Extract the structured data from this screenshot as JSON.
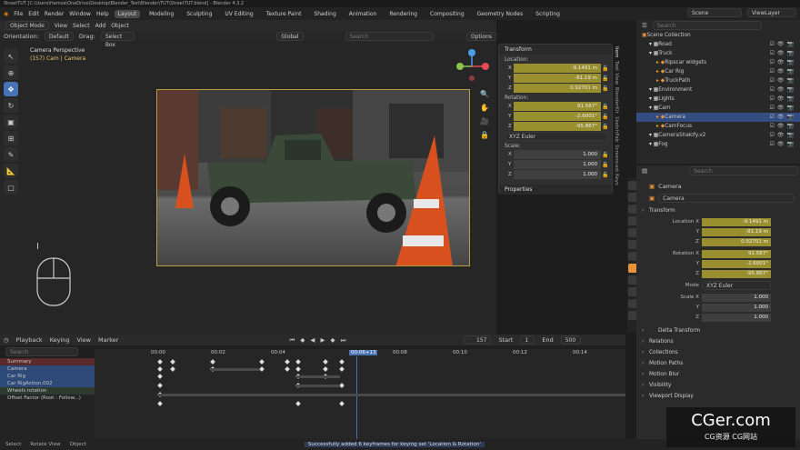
{
  "window": {
    "title": "StreetTUT [C:\\Users\\Hamza\\OneDrive\\Desktop\\Blender_Test\\Blender\\TUT\\StreetTUT.blend] - Blender 4.3.2"
  },
  "menu": [
    "File",
    "Edit",
    "Render",
    "Window",
    "Help"
  ],
  "workspaces": [
    "Layout",
    "Modeling",
    "Sculpting",
    "UV Editing",
    "Texture Paint",
    "Shading",
    "Animation",
    "Rendering",
    "Compositing",
    "Geometry Nodes",
    "Scripting"
  ],
  "scene": {
    "scene_name": "Scene",
    "view_layer": "ViewLayer"
  },
  "viewport": {
    "mode": "Object Mode",
    "menus": [
      "View",
      "Select",
      "Add",
      "Object"
    ],
    "orientation_label": "Orientation:",
    "orientation_value": "Default",
    "drag_label": "Drag:",
    "drag_value": "Select Box",
    "transform_orientation": "Global",
    "options": "Options",
    "camera_title": "Camera Perspective",
    "camera_sub": "(157) Cam | Camera",
    "search_placeholder": "Search"
  },
  "npanel": {
    "transform": "Transform",
    "location": "Location:",
    "loc": [
      {
        "axis": "X",
        "value": "-9.1491 m"
      },
      {
        "axis": "Y",
        "value": "-81.19 m"
      },
      {
        "axis": "Z",
        "value": "0.92701 m"
      }
    ],
    "rotation": "Rotation:",
    "rot": [
      {
        "axis": "X",
        "value": "91.567°"
      },
      {
        "axis": "Y",
        "value": "-2.6001°"
      },
      {
        "axis": "Z",
        "value": "-95.867°"
      }
    ],
    "rotation_mode": "XYZ Euler",
    "scale": "Scale:",
    "scl": [
      {
        "axis": "X",
        "value": "1.000"
      },
      {
        "axis": "Y",
        "value": "1.000"
      },
      {
        "axis": "Z",
        "value": "1.000"
      }
    ],
    "properties": "Properties",
    "side_tabs": [
      "Item",
      "Tool",
      "View",
      "BlenderKit",
      "SketchFab",
      "Screencast Keys"
    ]
  },
  "outliner": {
    "search_placeholder": "Search",
    "items": [
      {
        "name": "Scene Collection",
        "indent": 0,
        "sel": false
      },
      {
        "name": "Road",
        "indent": 1,
        "sel": false
      },
      {
        "name": "Truck",
        "indent": 1,
        "sel": false
      },
      {
        "name": "Ripscar widgets",
        "indent": 2,
        "sel": false
      },
      {
        "name": "Car Rig",
        "indent": 2,
        "sel": false
      },
      {
        "name": "TruckPath",
        "indent": 2,
        "sel": false
      },
      {
        "name": "Environment",
        "indent": 1,
        "sel": false
      },
      {
        "name": "Lights",
        "indent": 1,
        "sel": false
      },
      {
        "name": "Cam",
        "indent": 1,
        "sel": false
      },
      {
        "name": "Camera",
        "indent": 2,
        "sel": true
      },
      {
        "name": "CamFocus",
        "indent": 2,
        "sel": false
      },
      {
        "name": "CameraShakify.v2",
        "indent": 1,
        "sel": false
      },
      {
        "name": "Fog",
        "indent": 1,
        "sel": false
      }
    ]
  },
  "properties": {
    "search_placeholder": "Search",
    "object": "Camera",
    "object_name": "Camera",
    "transform": "Transform",
    "location": [
      {
        "label": "Location X",
        "value": "-9.1491 m"
      },
      {
        "label": "Y",
        "value": "-81.19 m"
      },
      {
        "label": "Z",
        "value": "0.92701 m"
      }
    ],
    "rotation": [
      {
        "label": "Rotation X",
        "value": "91.567°"
      },
      {
        "label": "Y",
        "value": "-2.6001°"
      },
      {
        "label": "Z",
        "value": "-95.867°"
      }
    ],
    "mode_label": "Mode",
    "mode_value": "XYZ Euler",
    "scale": [
      {
        "label": "Scale X",
        "value": "1.000"
      },
      {
        "label": "Y",
        "value": "1.000"
      },
      {
        "label": "Z",
        "value": "1.000"
      }
    ],
    "sections": [
      "Delta Transform",
      "Relations",
      "Collections",
      "Motion Paths",
      "Motion Blur",
      "Visibility",
      "Viewport Display"
    ]
  },
  "timeline": {
    "menus": [
      "Playback",
      "Keying",
      "View",
      "Marker"
    ],
    "current_frame": "157",
    "start_label": "Start",
    "start": "1",
    "end_label": "End",
    "end": "500",
    "search_placeholder": "Search",
    "ticks": [
      "00:00",
      "00:02",
      "00:04",
      "00:06+13",
      "00:08",
      "00:10",
      "00:12",
      "00:14"
    ],
    "channels": [
      {
        "name": "Summary",
        "cls": "sum"
      },
      {
        "name": "Camera",
        "cls": "blue"
      },
      {
        "name": "Car Rig",
        "cls": "blue"
      },
      {
        "name": "Car RigAction.002",
        "cls": "blue"
      },
      {
        "name": "Wheels rotation",
        "cls": "green"
      },
      {
        "name": "Offset Factor (Root : Follow...)",
        "cls": ""
      }
    ]
  },
  "status": {
    "items": [
      "Select",
      "Rotate View",
      "Object"
    ],
    "message": "Successfully added 6 keyframes for keying set 'Location & Rotation'"
  },
  "watermark": {
    "text1": "CGer.com",
    "text2": "CG资源 CG网站"
  }
}
